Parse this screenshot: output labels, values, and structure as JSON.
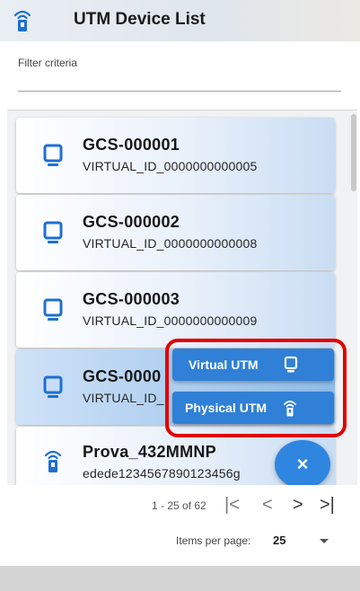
{
  "app": {
    "title": "UTM Device List",
    "icon": "physical-utm-icon"
  },
  "filter": {
    "label": "Filter criteria",
    "value": ""
  },
  "devices": [
    {
      "name": "GCS-000001",
      "id": "VIRTUAL_ID_0000000000005",
      "icon": "virtual-device-icon",
      "selected": false
    },
    {
      "name": "GCS-000002",
      "id": "VIRTUAL_ID_0000000000008",
      "icon": "virtual-device-icon",
      "selected": false
    },
    {
      "name": "GCS-000003",
      "id": "VIRTUAL_ID_0000000000009",
      "icon": "virtual-device-icon",
      "selected": false
    },
    {
      "name": "GCS-0000",
      "id": "VIRTUAL_ID_",
      "icon": "virtual-device-icon",
      "selected": true
    },
    {
      "name": "Prova_432MMNP",
      "id": "edede1234567890123456g",
      "icon": "physical-device-icon",
      "selected": false
    }
  ],
  "fab_menu": {
    "virtual_label": "Virtual UTM",
    "virtual_icon": "virtual-device-icon",
    "physical_label": "Physical UTM",
    "physical_icon": "physical-utm-icon",
    "close_label": "×"
  },
  "paginator": {
    "range": "1 - 25 of 62",
    "first": "|<",
    "prev": "<",
    "next": ">",
    "last": ">|",
    "items_per_page_label": "Items per page:",
    "items_per_page_value": "25"
  },
  "colors": {
    "accent": "#2f80d6",
    "highlight": "#e00000",
    "icon_blue": "#1f6fd1"
  }
}
